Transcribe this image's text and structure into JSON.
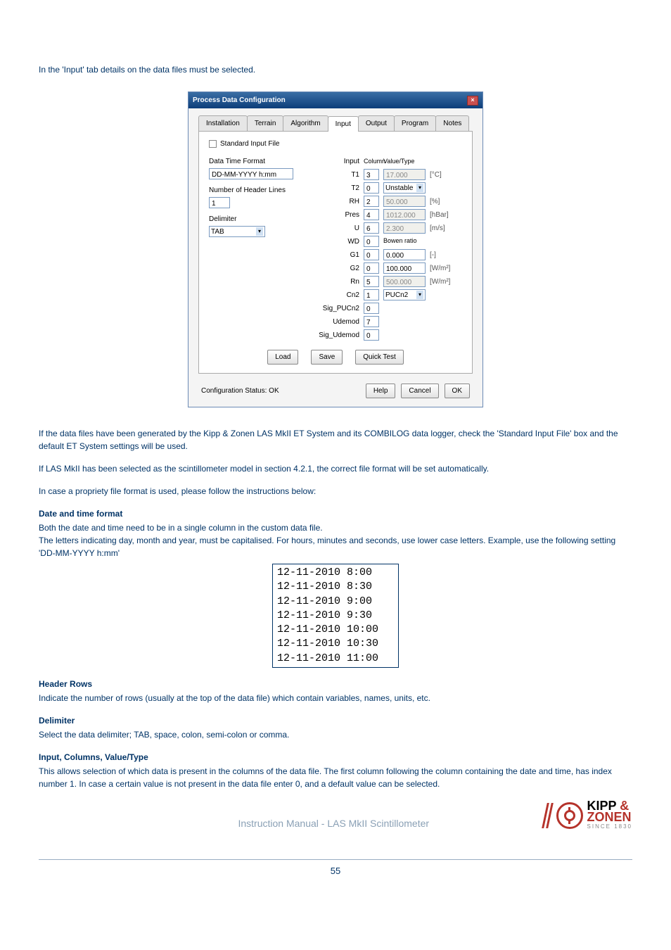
{
  "intro": "In the 'Input' tab details on the data files must be selected.",
  "dialog": {
    "title": "Process Data Configuration",
    "tabs": {
      "t0": "Installation",
      "t1": "Terrain",
      "t2": "Algorithm",
      "t3": "Input",
      "t4": "Output",
      "t5": "Program",
      "t6": "Notes"
    },
    "std_label": "Standard Input File",
    "left": {
      "date_label": "Data Time Format",
      "date_value": "DD-MM-YYYY h:mm",
      "header_label": "Number of Header Lines",
      "header_value": "1",
      "delim_label": "Delimiter",
      "delim_value": "TAB"
    },
    "cols": {
      "hdr_input": "Input",
      "hdr_column": "Column",
      "hdr_vt": "Value/Type"
    },
    "rows": {
      "t1": {
        "lbl": "T1",
        "col": "3",
        "val": "17.000",
        "unit": "[°C]"
      },
      "t2": {
        "lbl": "T2",
        "col": "0",
        "val": "Unstable",
        "unit": ""
      },
      "rh": {
        "lbl": "RH",
        "col": "2",
        "val": "50.000",
        "unit": "[%]"
      },
      "pres": {
        "lbl": "Pres",
        "col": "4",
        "val": "1012.000",
        "unit": "[hBar]"
      },
      "u": {
        "lbl": "U",
        "col": "6",
        "val": "2.300",
        "unit": "[m/s]"
      },
      "wd": {
        "lbl": "WD",
        "col": "0",
        "val": "Bowen ratio",
        "unit": ""
      },
      "g1": {
        "lbl": "G1",
        "col": "0",
        "val": "0.000",
        "unit": "[-]"
      },
      "g2": {
        "lbl": "G2",
        "col": "0",
        "val": "100.000",
        "unit": "[W/m²]"
      },
      "rn": {
        "lbl": "Rn",
        "col": "5",
        "val": "500.000",
        "unit": "[W/m²]"
      },
      "cn2": {
        "lbl": "Cn2",
        "col": "1",
        "val": "PUCn2",
        "unit": ""
      },
      "sigp": {
        "lbl": "Sig_PUCn2",
        "col": "0"
      },
      "ud": {
        "lbl": "Udemod",
        "col": "7"
      },
      "sigu": {
        "lbl": "Sig_Udemod",
        "col": "0"
      }
    },
    "buttons": {
      "load": "Load",
      "save": "Save",
      "quick": "Quick Test",
      "help": "Help",
      "cancel": "Cancel",
      "ok": "OK"
    },
    "status": "Configuration Status: OK"
  },
  "p1": "If the data files have been generated by the Kipp & Zonen LAS MkII ET System and its COMBILOG data logger, check the 'Standard Input File' box and the default ET System settings will be used.",
  "p2": "If LAS MkII has been selected as the scintillometer model in section 4.2.1, the correct file format will be set automatically.",
  "p3": "In case a propriety file format is used, please follow the instructions below:",
  "sec_date_head": "Date and time format",
  "sec_date_p1": "Both the date and time need to be in a single column in the custom data file.",
  "sec_date_p2": "The letters indicating day, month and year, must be capitalised. For hours, minutes and seconds, use lower case letters. Example, use the following setting 'DD-MM-YYYY  h:mm'",
  "date_samples": {
    "r0": "12-11-2010  8:00",
    "r1": "12-11-2010  8:30",
    "r2": "12-11-2010  9:00",
    "r3": "12-11-2010  9:30",
    "r4": "12-11-2010  10:00",
    "r5": "12-11-2010  10:30",
    "r6": "12-11-2010  11:00"
  },
  "sec_header_head": "Header Rows",
  "sec_header_p": "Indicate the number of rows (usually at the top of the data file) which contain variables, names, units, etc.",
  "sec_delim_head": "Delimiter",
  "sec_delim_p": "Select the data delimiter; TAB, space, colon, semi-colon or comma.",
  "sec_ict_head": "Input, Columns, Value/Type",
  "sec_ict_p": "This allows selection of which data is present in the columns of the data file. The first column following the column containing the date and time, has index number 1. In case a certain value is not present in the data file enter 0, and a default value can be selected.",
  "footer": {
    "text": "Instruction Manual - LAS MkII Scintillometer",
    "brand1": "KIPP ",
    "brand_amp": "&",
    "brand2": "ZONEN",
    "since": "SINCE 1830",
    "page": "55"
  }
}
